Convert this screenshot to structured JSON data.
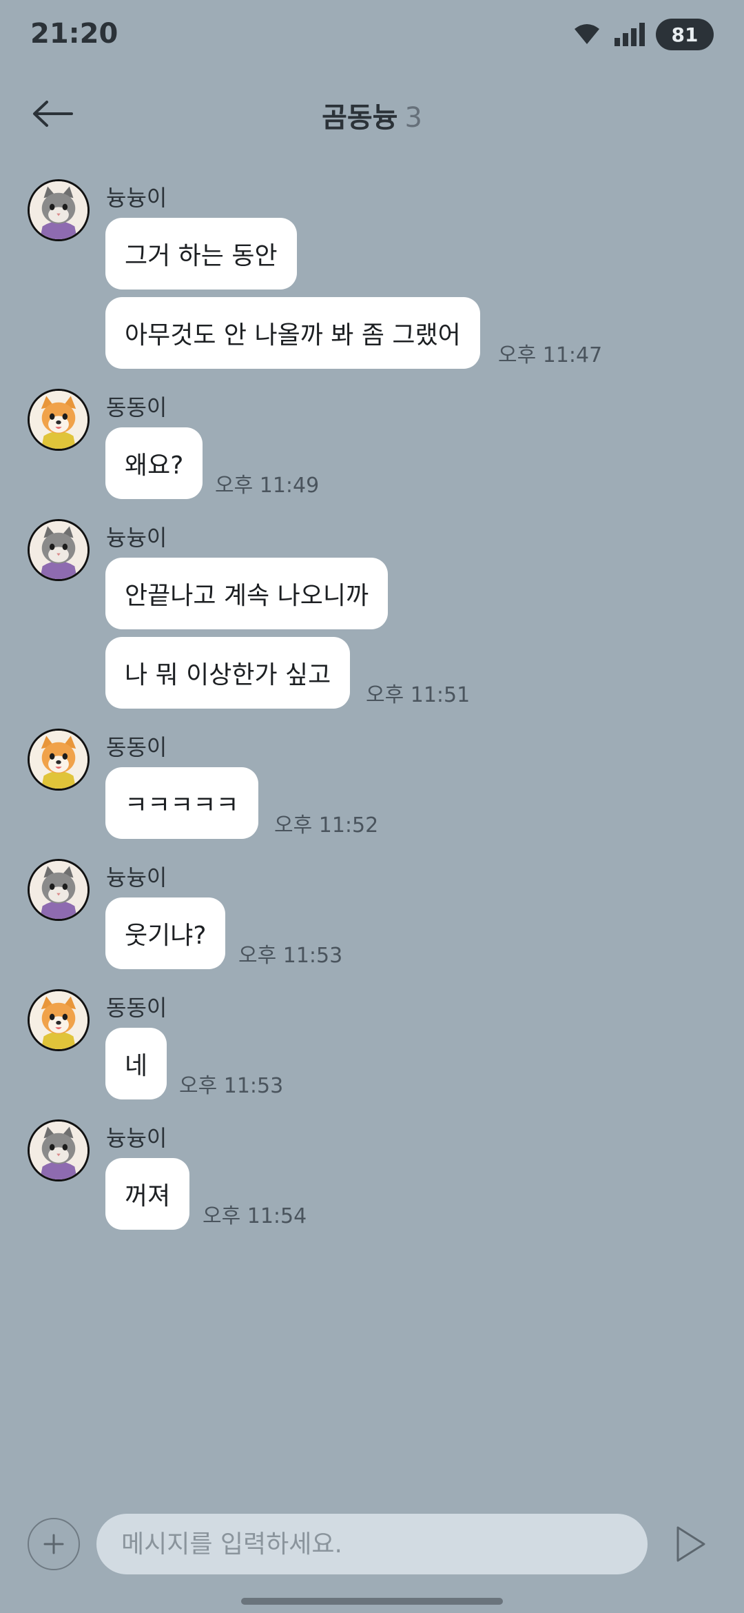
{
  "status_bar": {
    "time": "21:20",
    "battery": "81"
  },
  "header": {
    "title": "곰동늉",
    "member_count": "3"
  },
  "messages": [
    {
      "sender": "늉늉이",
      "avatar": "cat-avatar",
      "bubbles": [
        "그거 하는 동안",
        "아무것도 안 나올까 봐 좀 그랬어"
      ],
      "time": "오후 11:47"
    },
    {
      "sender": "동동이",
      "avatar": "dog-avatar",
      "bubbles": [
        "왜요?"
      ],
      "time": "오후 11:49"
    },
    {
      "sender": "늉늉이",
      "avatar": "cat-avatar",
      "bubbles": [
        "안끝나고 계속 나오니까",
        "나 뭐 이상한가 싶고"
      ],
      "time": "오후 11:51"
    },
    {
      "sender": "동동이",
      "avatar": "dog-avatar",
      "bubbles": [
        "ㅋㅋㅋㅋㅋ"
      ],
      "time": "오후 11:52"
    },
    {
      "sender": "늉늉이",
      "avatar": "cat-avatar",
      "bubbles": [
        "웃기냐?"
      ],
      "time": "오후 11:53"
    },
    {
      "sender": "동동이",
      "avatar": "dog-avatar",
      "bubbles": [
        "네"
      ],
      "time": "오후 11:53"
    },
    {
      "sender": "늉늉이",
      "avatar": "cat-avatar",
      "bubbles": [
        "꺼져"
      ],
      "time": "오후 11:54"
    }
  ],
  "input": {
    "placeholder": "메시지를 입력하세요."
  },
  "icons": [
    "wifi-icon",
    "signal-icon",
    "back-arrow-icon",
    "plus-icon",
    "send-icon"
  ],
  "colors": {
    "background": "#9eacb6",
    "bubble": "#ffffff",
    "input": "#d2dbe2",
    "text": "#2b3238"
  }
}
